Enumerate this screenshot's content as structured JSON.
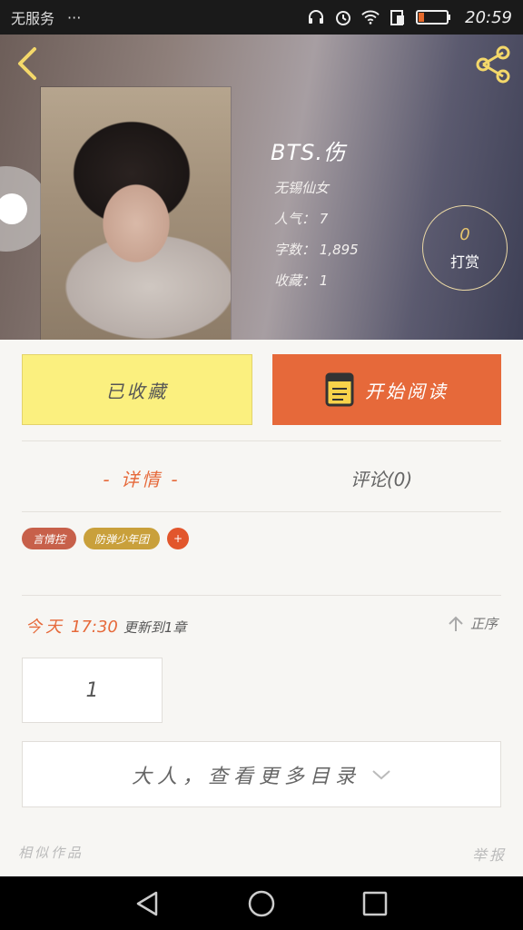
{
  "status_bar": {
    "carrier": "无服务",
    "dots": "···",
    "time": "20:59"
  },
  "book": {
    "title": "BTS.伤",
    "author": "无锡仙女",
    "popularity": "人气： 7",
    "words": "字数： 1,895",
    "favorites": "收藏： 1",
    "tip_count": "0",
    "tip_label": "打赏"
  },
  "actions": {
    "collected_label": "已收藏",
    "read_label": "开始阅读"
  },
  "tabs": {
    "details": "- 详情 -",
    "comments": "评论(0)"
  },
  "tags": [
    {
      "label": "言情控",
      "color": "#c7604a"
    },
    {
      "label": "防弹少年团",
      "color": "#c9a03b"
    },
    {
      "label": "+",
      "color": "#e2562c"
    }
  ],
  "update": {
    "day": "今天",
    "time": "17:30",
    "text": "更新到1章",
    "sort_label": "正序"
  },
  "chapters": {
    "first": "1",
    "more_label": "大人，查看更多目录"
  },
  "footer": {
    "similar": "相似作品",
    "report": "举报"
  },
  "icons": {
    "back": "chevron-left-icon",
    "share": "share-icon",
    "book": "book-icon",
    "sort": "arrow-up-icon",
    "expand": "chevron-down-icon"
  },
  "colors": {
    "accent": "#e6693a",
    "collected_bg": "#fbf07f",
    "tip_ring": "#e9d7a4",
    "tip_count": "#e6c56e"
  }
}
